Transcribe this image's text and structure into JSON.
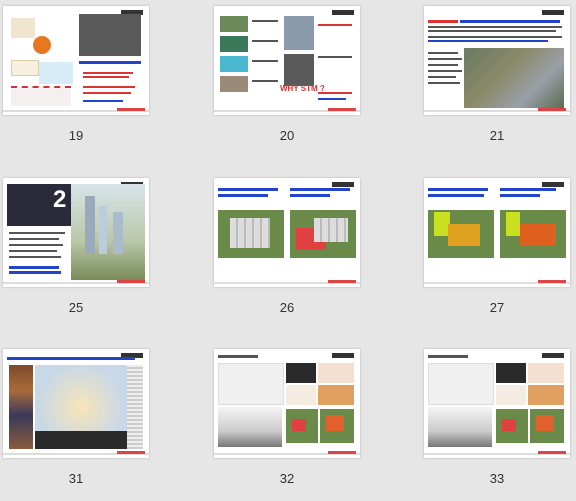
{
  "slides": [
    {
      "number": "19"
    },
    {
      "number": "20",
      "heading": "WHY STM ?"
    },
    {
      "number": "21"
    },
    {
      "number": "25",
      "badge": "2"
    },
    {
      "number": "26"
    },
    {
      "number": "27"
    },
    {
      "number": "31"
    },
    {
      "number": "32"
    },
    {
      "number": "33"
    }
  ]
}
